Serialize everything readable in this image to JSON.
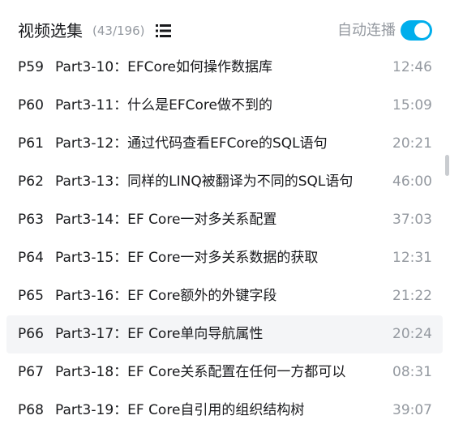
{
  "header": {
    "title": "视频选集",
    "count": "(43/196)",
    "list_icon": "list-view-icon",
    "autoplay_label": "自动连播",
    "autoplay_on": true,
    "accent": "#00aeec"
  },
  "episodes": [
    {
      "ep": "P59",
      "title": "Part3-10：EFCore如何操作数据库",
      "duration": "12:46"
    },
    {
      "ep": "P60",
      "title": "Part3-11：什么是EFCore做不到的",
      "duration": "15:09"
    },
    {
      "ep": "P61",
      "title": "Part3-12：通过代码查看EFCore的SQL语句",
      "duration": "20:21"
    },
    {
      "ep": "P62",
      "title": "Part3-13：同样的LINQ被翻译为不同的SQL语句",
      "duration": "46:00"
    },
    {
      "ep": "P63",
      "title": "Part3-14：EF Core一对多关系配置",
      "duration": "37:03"
    },
    {
      "ep": "P64",
      "title": "Part3-15：EF Core一对多关系数据的获取",
      "duration": "12:31"
    },
    {
      "ep": "P65",
      "title": "Part3-16：EF Core额外的外键字段",
      "duration": "21:22"
    },
    {
      "ep": "P66",
      "title": "Part3-17：EF Core单向导航属性",
      "duration": "20:24"
    },
    {
      "ep": "P67",
      "title": "Part3-18：EF Core关系配置在任何一方都可以",
      "duration": "08:31"
    },
    {
      "ep": "P68",
      "title": "Part3-19：EF Core自引用的组织结构树",
      "duration": "39:07"
    }
  ],
  "hovered_episode": "P66"
}
